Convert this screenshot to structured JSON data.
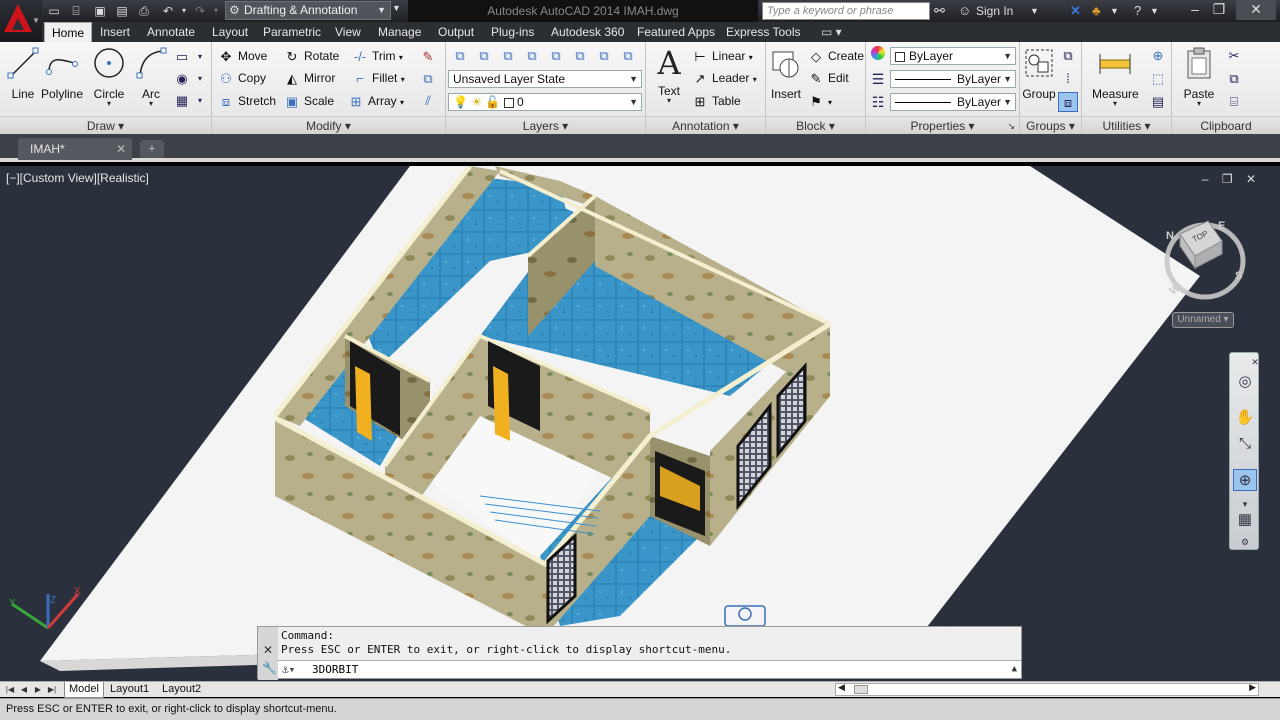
{
  "title_bar": {
    "workspace": "Drafting & Annotation",
    "app_title": "Autodesk AutoCAD 2014    IMAH.dwg",
    "search_placeholder": "Type a keyword or phrase",
    "sign_in": "Sign In"
  },
  "ribbon_tabs": [
    "Home",
    "Insert",
    "Annotate",
    "Layout",
    "Parametric",
    "View",
    "Manage",
    "Output",
    "Plug-ins",
    "Autodesk 360",
    "Featured Apps",
    "Express Tools"
  ],
  "active_tab": "Home",
  "panels": {
    "draw": {
      "title": "Draw",
      "tools": [
        "Line",
        "Polyline",
        "Circle",
        "Arc"
      ]
    },
    "modify": {
      "title": "Modify",
      "tools": [
        "Move",
        "Rotate",
        "Trim",
        "Copy",
        "Mirror",
        "Fillet",
        "Stretch",
        "Scale",
        "Array"
      ]
    },
    "layers": {
      "title": "Layers",
      "layer_state": "Unsaved Layer State",
      "current_layer": "0"
    },
    "annotation": {
      "title": "Annotation",
      "text": "Text",
      "linear": "Linear",
      "leader": "Leader",
      "table": "Table"
    },
    "block": {
      "title": "Block",
      "insert": "Insert",
      "create": "Create",
      "edit": "Edit"
    },
    "properties": {
      "title": "Properties",
      "color": "ByLayer",
      "linetype": "ByLayer",
      "lineweight": "ByLayer"
    },
    "groups": {
      "title": "Groups",
      "group": "Group"
    },
    "utilities": {
      "title": "Utilities",
      "measure": "Measure"
    },
    "clipboard": {
      "title": "Clipboard",
      "paste": "Paste"
    }
  },
  "file_tab": "IMAH*",
  "viewport": {
    "label": "[−][Custom View][Realistic]",
    "viewcube_top": "TOP",
    "viewcube_n": "N",
    "viewcube_s": "S",
    "viewcube_w": "W",
    "viewcube_e": "E",
    "ucs_name": "Unnamed"
  },
  "command_line": {
    "history_1": "Command:",
    "history_2": "Press ESC or ENTER to exit, or right-click to display shortcut-menu.",
    "current": "3DORBIT"
  },
  "layout_tabs": [
    "Model",
    "Layout1",
    "Layout2"
  ],
  "status_text": "Press ESC or ENTER to exit, or right-click to display shortcut-menu."
}
